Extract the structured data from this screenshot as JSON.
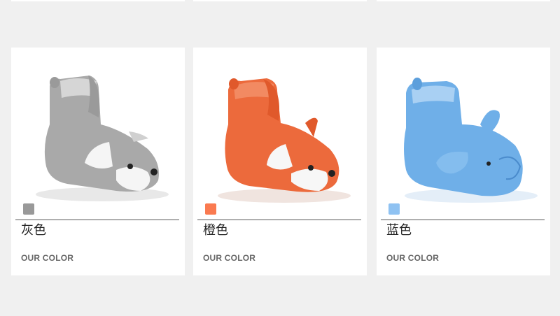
{
  "cards": [
    {
      "color_name": "灰色",
      "subtitle": "OUR COLOR",
      "swatch": "#999999",
      "product_icon": "gray-fox-bootie"
    },
    {
      "color_name": "橙色",
      "subtitle": "OUR COLOR",
      "swatch": "#fa7a50",
      "product_icon": "orange-fox-bootie"
    },
    {
      "color_name": "蓝色",
      "subtitle": "OUR COLOR",
      "swatch": "#8fc2f2",
      "product_icon": "blue-elephant-bootie"
    }
  ]
}
